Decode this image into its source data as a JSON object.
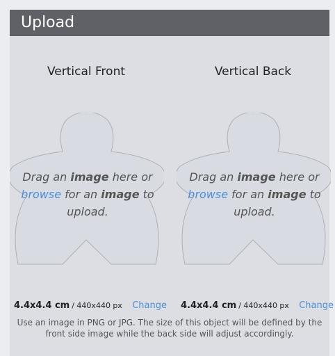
{
  "header": {
    "title": "Upload"
  },
  "front": {
    "title": "Vertical Front",
    "drop": {
      "p1": "Drag an ",
      "b1": "image",
      "p2": " here or ",
      "link": "browse",
      "p3": " for an ",
      "b2": "image",
      "p4": " to upload."
    },
    "size": "4.4x4.4 cm",
    "size_px": "/ 440x440 px",
    "change": "Change"
  },
  "back": {
    "title": "Vertical Back",
    "drop": {
      "p1": "Drag an ",
      "b1": "image",
      "p2": " here or ",
      "link": "browse",
      "p3": " for an ",
      "b2": "image",
      "p4": " to upload."
    },
    "size": "4.4x4.4 cm",
    "size_px": "/ 440x440 px",
    "change": "Change"
  },
  "help": "Use an image in PNG or JPG. The size of this object will be defined by the front side image while the back side will adjust accordingly.",
  "colors": {
    "header_bg": "#5f6166",
    "link": "#4a90d9",
    "panel_bg": "#dcdee3"
  }
}
